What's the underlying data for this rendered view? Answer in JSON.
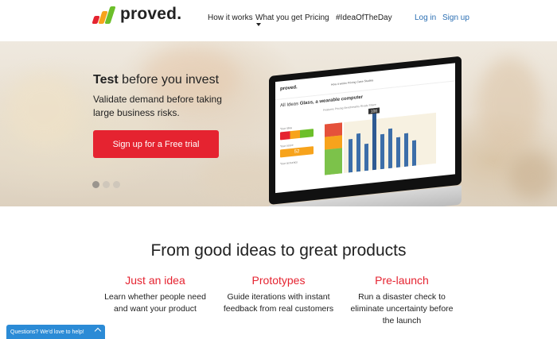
{
  "header": {
    "logo_text": "proved.",
    "nav": [
      "How it works",
      "What you get",
      "Pricing",
      "#IdeaOfTheDay"
    ],
    "login": "Log in",
    "signup": "Sign up"
  },
  "hero": {
    "title_bold": "Test",
    "title_rest": " before you invest",
    "subtitle": "Validate demand before taking large business risks.",
    "cta": "Sign up for a Free trial",
    "slides": 3,
    "active_slide": 1
  },
  "screen": {
    "logo": "proved.",
    "menu": "How it works   Pricing   Case Studies",
    "title_prefix": "All Ideas",
    "title": "Glass, a wearable computer",
    "tabs": "Features   Pricing   Benchmarks   Rivals   Share",
    "label_1": "Your idea",
    "label_2": "Your score",
    "score": "52",
    "label_3": "Your accuracy",
    "bar_value": "100"
  },
  "section": {
    "title": "From good ideas to great products",
    "columns": [
      {
        "title": "Just an idea",
        "text": "Learn whether people need and want your product"
      },
      {
        "title": "Prototypes",
        "text": "Guide iterations with instant feedback from real customers"
      },
      {
        "title": "Pre-launch",
        "text": "Run a disaster check to eliminate uncertainty before the launch"
      }
    ]
  },
  "chat": {
    "label": "Questions? We'd love to help!"
  },
  "colors": {
    "brand_red": "#e52330",
    "link_blue": "#2b6fb3",
    "chat_blue": "#2b8bd6"
  }
}
